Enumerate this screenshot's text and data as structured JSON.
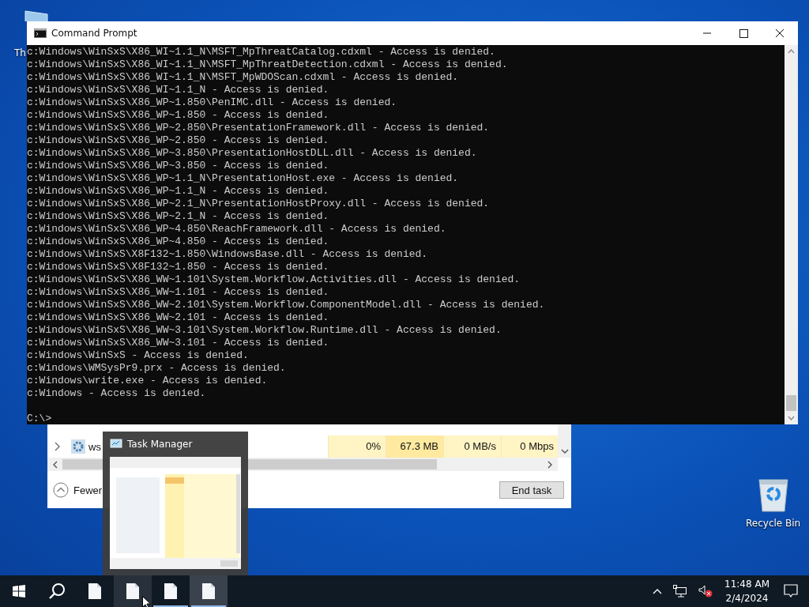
{
  "desktop_icons": [
    {
      "label": "Th",
      "kind": "folder"
    },
    {
      "label": "Recycle Bin",
      "kind": "recycle"
    }
  ],
  "command_prompt": {
    "title": "Command Prompt",
    "lines": [
      "c:Windows\\WinSxS\\X86_WI~1.1_N\\MSFT_MpThreatCatalog.cdxml - Access is denied.",
      "c:Windows\\WinSxS\\X86_WI~1.1_N\\MSFT_MpThreatDetection.cdxml - Access is denied.",
      "c:Windows\\WinSxS\\X86_WI~1.1_N\\MSFT_MpWDOScan.cdxml - Access is denied.",
      "c:Windows\\WinSxS\\X86_WI~1.1_N - Access is denied.",
      "c:Windows\\WinSxS\\X86_WP~1.850\\PenIMC.dll - Access is denied.",
      "c:Windows\\WinSxS\\X86_WP~1.850 - Access is denied.",
      "c:Windows\\WinSxS\\X86_WP~2.850\\PresentationFramework.dll - Access is denied.",
      "c:Windows\\WinSxS\\X86_WP~2.850 - Access is denied.",
      "c:Windows\\WinSxS\\X86_WP~3.850\\PresentationHostDLL.dll - Access is denied.",
      "c:Windows\\WinSxS\\X86_WP~3.850 - Access is denied.",
      "c:Windows\\WinSxS\\X86_WP~1.1_N\\PresentationHost.exe - Access is denied.",
      "c:Windows\\WinSxS\\X86_WP~1.1_N - Access is denied.",
      "c:Windows\\WinSxS\\X86_WP~2.1_N\\PresentationHostProxy.dll - Access is denied.",
      "c:Windows\\WinSxS\\X86_WP~2.1_N - Access is denied.",
      "c:Windows\\WinSxS\\X86_WP~4.850\\ReachFramework.dll - Access is denied.",
      "c:Windows\\WinSxS\\X86_WP~4.850 - Access is denied.",
      "c:Windows\\WinSxS\\X8F132~1.850\\WindowsBase.dll - Access is denied.",
      "c:Windows\\WinSxS\\X8F132~1.850 - Access is denied.",
      "c:Windows\\WinSxS\\X86_WW~1.101\\System.Workflow.Activities.dll - Access is denied.",
      "c:Windows\\WinSxS\\X86_WW~1.101 - Access is denied.",
      "c:Windows\\WinSxS\\X86_WW~2.101\\System.Workflow.ComponentModel.dll - Access is denied.",
      "c:Windows\\WinSxS\\X86_WW~2.101 - Access is denied.",
      "c:Windows\\WinSxS\\X86_WW~3.101\\System.Workflow.Runtime.dll - Access is denied.",
      "c:Windows\\WinSxS\\X86_WW~3.101 - Access is denied.",
      "c:Windows\\WinSxS - Access is denied.",
      "c:Windows\\WMSysPr9.prx - Access is denied.",
      "c:Windows\\write.exe - Access is denied.",
      "c:Windows - Access is denied."
    ],
    "prompt": "C:\\>"
  },
  "task_manager": {
    "rows": [
      {
        "name": "ws",
        "cpu": "0%",
        "memory": "67.3 MB",
        "disk": "0 MB/s",
        "network": "0 Mbps"
      }
    ],
    "fewer_details": "Fewer",
    "end_task": "End task"
  },
  "thumbnail": {
    "title": "Task Manager",
    "kind": "picture"
  },
  "taskbar": {
    "apps": [
      {
        "running": false,
        "selected": false,
        "hovered": false
      },
      {
        "running": false,
        "selected": false,
        "hovered": true
      },
      {
        "running": true,
        "selected": false,
        "hovered": false
      },
      {
        "running": true,
        "selected": true,
        "hovered": false
      }
    ],
    "time": "11:48 AM",
    "date": "2/4/2024"
  }
}
